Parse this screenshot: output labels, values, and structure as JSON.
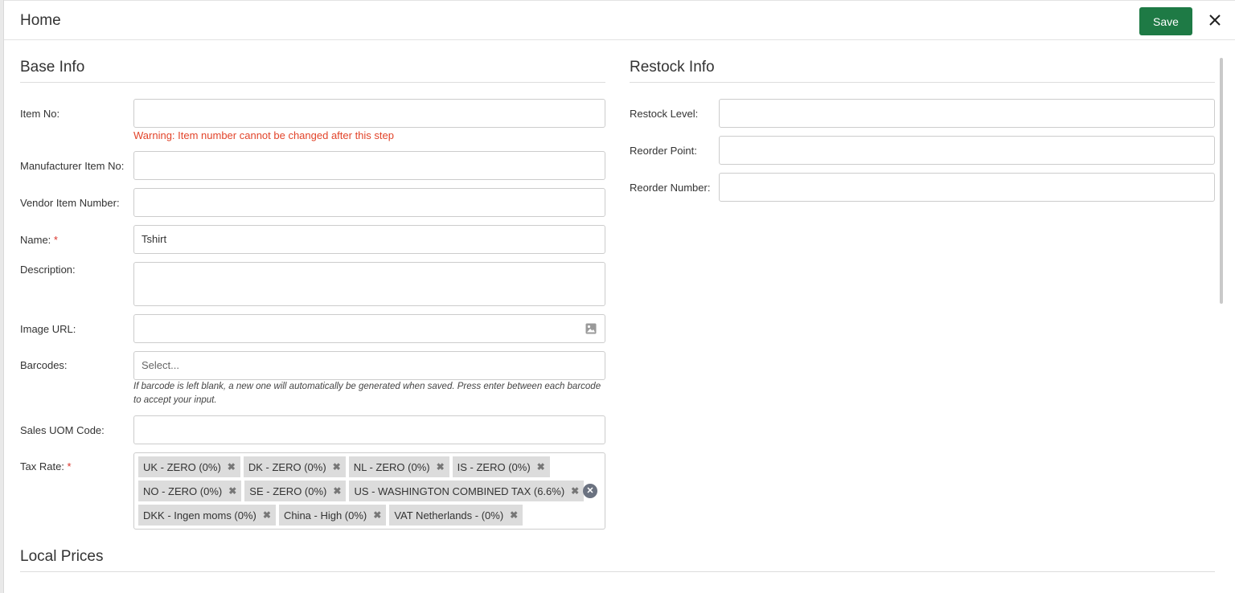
{
  "header": {
    "title": "Home",
    "save_label": "Save",
    "close_icon": "close-icon"
  },
  "base_info": {
    "title": "Base Info",
    "item_no": {
      "label": "Item No:",
      "value": "",
      "warning": "Warning: Item number cannot be changed after this step"
    },
    "manufacturer_item_no": {
      "label": "Manufacturer Item No:",
      "value": ""
    },
    "vendor_item_number": {
      "label": "Vendor Item Number:",
      "value": ""
    },
    "name": {
      "label": "Name:",
      "required_mark": "*",
      "value": "Tshirt"
    },
    "description": {
      "label": "Description:",
      "value": ""
    },
    "image_url": {
      "label": "Image URL:",
      "value": "",
      "icon": "image-icon"
    },
    "barcodes": {
      "label": "Barcodes:",
      "placeholder": "Select...",
      "hint": "If barcode is left blank, a new one will automatically be generated when saved. Press enter between each barcode to accept your input."
    },
    "sales_uom_code": {
      "label": "Sales UOM Code:",
      "value": ""
    },
    "tax_rate": {
      "label": "Tax Rate:",
      "required_mark": "*",
      "tag_rows": [
        [
          "UK - ZERO (0%)",
          "DK - ZERO (0%)",
          "NL - ZERO (0%)",
          "IS - ZERO (0%)"
        ],
        [
          "NO - ZERO (0%)",
          "SE - ZERO (0%)",
          "US - WASHINGTON COMBINED TAX (6.6%)"
        ],
        [
          "DKK - Ingen moms (0%)",
          "China - High (0%)",
          "VAT Netherlands - (0%)"
        ]
      ],
      "remove_glyph": "✖",
      "clear_glyph": "✕"
    }
  },
  "restock_info": {
    "title": "Restock Info",
    "restock_level": {
      "label": "Restock Level:",
      "value": ""
    },
    "reorder_point": {
      "label": "Reorder Point:",
      "value": ""
    },
    "reorder_number": {
      "label": "Reorder Number:",
      "value": ""
    }
  },
  "local_prices": {
    "title": "Local Prices"
  },
  "colors": {
    "primary": "#1e7a45",
    "warning": "#e2442a",
    "required": "#d9342b",
    "tag_bg": "#dcdcdc"
  }
}
